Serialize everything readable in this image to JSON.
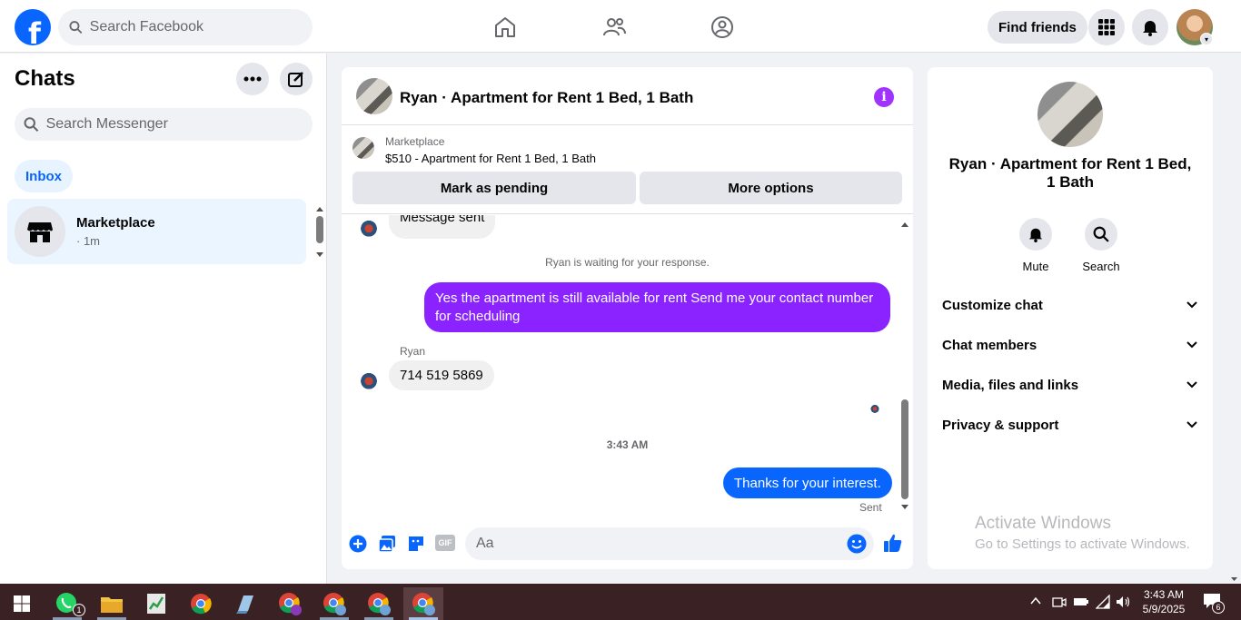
{
  "topbar": {
    "search_placeholder": "Search Facebook",
    "find_friends_label": "Find friends",
    "logo_letter": "f"
  },
  "left": {
    "title": "Chats",
    "search_placeholder": "Search Messenger",
    "inbox_label": "Inbox",
    "chats": [
      {
        "name": "Marketplace",
        "sub": "· 1m"
      }
    ]
  },
  "conversation": {
    "title": "Ryan · Apartment for Rent 1 Bed, 1 Bath",
    "info_symbol": "i",
    "marketplace_label": "Marketplace",
    "listing": "$510 - Apartment for Rent 1 Bed, 1 Bath",
    "mark_pending": "Mark as pending",
    "more_options": "More options",
    "messages": {
      "partial_in": "Message sent",
      "waiting": "Ryan is waiting for your response.",
      "out1": "Yes the apartment is still available for rent Send me your contact number for scheduling",
      "sender_name": "Ryan",
      "in1": "714 519 5869",
      "time": "3:43 AM",
      "out2": "Thanks for your interest.",
      "status": "Sent"
    },
    "composer_placeholder": "Aa",
    "gif_label": "GIF"
  },
  "details": {
    "name": "Ryan · Apartment for Rent 1 Bed, 1 Bath",
    "mute_label": "Mute",
    "search_label": "Search",
    "sections": [
      "Customize chat",
      "Chat members",
      "Media, files and links",
      "Privacy & support"
    ],
    "watermark_title": "Activate Windows",
    "watermark_sub": "Go to Settings to activate Windows."
  },
  "taskbar": {
    "time": "3:43 AM",
    "date": "5/9/2025",
    "whatsapp_badge": "1",
    "notification_count": "6"
  },
  "colors": {
    "brand_blue": "#0866ff",
    "purple_bubble": "#8a23ff",
    "taskbar": "#3a2123"
  }
}
